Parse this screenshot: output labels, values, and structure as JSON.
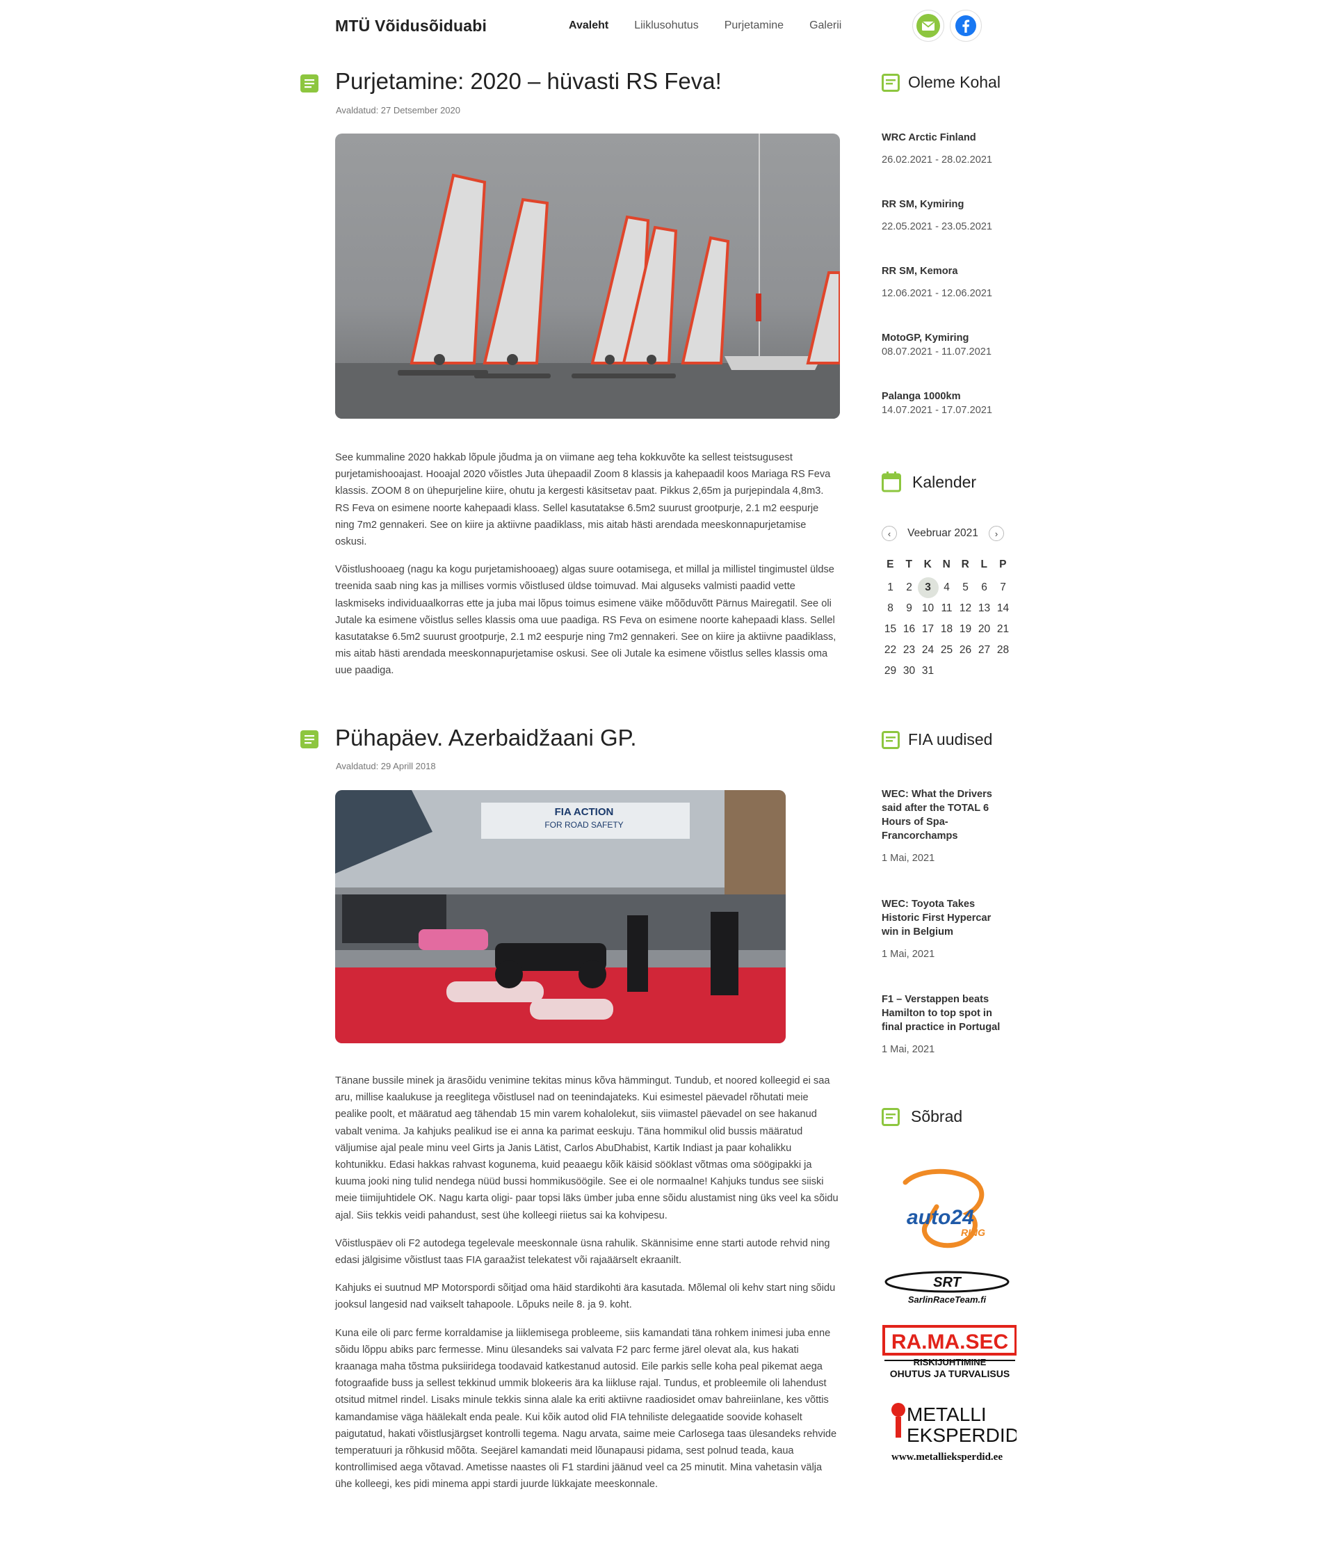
{
  "header": {
    "brand": "MTÜ Võidusõiduabi",
    "nav": [
      {
        "label": "Avaleht",
        "active": true
      },
      {
        "label": "Liiklusohutus",
        "active": false
      },
      {
        "label": "Purjetamine",
        "active": false
      },
      {
        "label": "Galerii",
        "active": false
      }
    ],
    "social": [
      "mail-icon",
      "facebook-icon"
    ]
  },
  "posts": [
    {
      "title": "Purjetamine: 2020 – hüvasti RS Feva!",
      "date": "Avaldatud: 27 Detsember 2020",
      "image": "sailboats-racing-photo",
      "paragraphs": [
        "See kummaline 2020 hakkab lõpule jõudma ja on viimane aeg teha kokkuvõte ka sellest teistsugusest purjetamishooajast. Hooajal 2020 võistles Juta ühepaadil Zoom 8 klassis ja kahepaadil koos Mariaga RS Feva klassis. ZOOM 8 on ühepurjeline kiire, ohutu ja kergesti käsitsetav paat. Pikkus 2,65m ja purjepindala 4,8m3. RS Feva on esimene noorte kahepaadi klass.  Sellel kasutatakse 6.5m2 suurust grootpurje, 2.1 m2 eespurje ning 7m2 gennakeri. See on kiire ja aktiivne paadiklass, mis aitab hästi arendada meeskonnapurjetamise oskusi.",
        "Võistlushooaeg (nagu ka kogu purjetamishooaeg) algas suure ootamisega, et millal ja millistel tingimustel üldse treenida saab ning kas ja millises vormis võistlused üldse toimuvad. Mai alguseks valmisti paadid vette laskmiseks individuaalkorras ette ja juba mai lõpus toimus esimene väike mõõduvõtt Pärnus Mairegatil. See oli Jutale ka esimene võistlus selles klassis oma uue paadiga. RS Feva on esimene noorte kahepaadi klass.  Sellel kasutatakse 6.5m2 suurust grootpurje, 2.1 m2 eespurje ning 7m2 gennakeri. See on kiire ja aktiivne paadiklass, mis aitab hästi arendada meeskonnapurjetamise oskusi. See oli Jutale ka esimene võistlus selles klassis oma uue paadiga."
      ]
    },
    {
      "title": "Pühapäev. Azerbaidžaani GP.",
      "date": "Avaldatud: 29 Aprill 2018",
      "image": "f1-parc-ferme-photo",
      "image_banner": [
        "FIA ACTION",
        "FOR ROAD SAFETY"
      ],
      "paragraphs": [
        "Tänane bussile minek ja ärasõidu venimine tekitas minus kõva hämmingut. Tundub, et noored kolleegid ei saa aru, millise kaalukuse ja reeglitega võistlusel nad on teenindajateks. Kui esimestel päevadel rõhutati meie pealike poolt,  et määratud aeg tähendab 15 min varem kohalolekut, siis viimastel päevadel on see hakanud vabalt venima. Ja kahjuks pealikud ise ei anna ka parimat eeskuju. Täna hommikul olid bussis määratud väljumise ajal peale minu veel Girts ja Janis Lätist, Carlos AbuDhabist, Kartik Indiast ja paar kohalikku kohtunikku. Edasi hakkas rahvast kogunema, kuid peaaegu kõik käisid sööklast võtmas oma söögipakki ja kuuma jooki ning tulid nendega nüüd bussi hommikusöögile. See ei ole normaalne! Kahjuks tundus see siiski meie tiimijuhtidele OK. Nagu karta oligi- paar topsi läks ümber juba enne sõidu alustamist ning üks veel ka sõidu ajal. Siis tekkis veidi pahandust, sest ühe kolleegi riietus sai ka kohvipesu.",
        "Võistluspäev oli F2 autodega tegelevale meeskonnale üsna rahulik. Skännisime enne starti autode rehvid ning edasi jälgisime võistlust taas FIA garaažist telekatest või rajaäärselt ekraanilt.",
        "Kahjuks ei suutnud MP Motorspordi sõitjad oma häid stardikohti ära kasutada. Mõlemal oli kehv start ning sõidu jooksul langesid nad vaikselt tahapoole. Lõpuks neile 8. ja 9. koht.",
        "Kuna eile oli parc ferme korraldamise ja liiklemisega probleeme, siis kamandati täna rohkem inimesi juba enne sõidu lõppu abiks parc fermesse. Minu ülesandeks sai valvata F2 parc ferme järel olevat ala, kus hakati kraanaga maha tõstma puksiiridega toodavaid katkestanud autosid. Eile parkis selle koha peal pikemat aega fotograafide buss ja sellest tekkinud ummik blokeeris ära ka liikluse rajal. Tundus, et probleemile oli lahendust otsitud mitmel rindel. Lisaks minule tekkis sinna alale ka eriti aktiivne raadiosidet omav bahreiinlane, kes võttis kamandamise väga häälekalt enda peale. Kui kõik autod olid FIA tehniliste delegaatide soovide kohaselt paigutatud, hakati võistlusjärgset kontrolli tegema. Nagu arvata, saime meie Carlosega taas ülesandeks rehvide temperatuuri ja rõhkusid mõõta. Seejärel kamandati meid lõunapausi pidama, sest polnud teada, kaua kontrollimised aega võtavad. Ametisse naastes oli F1 stardini jäänud veel ca 25 minutit. Mina vahetasin välja ühe kolleegi, kes pidi minema appi stardi juurde lükkajate meeskonnale."
      ]
    }
  ],
  "sidebar": {
    "oleme_kohal": {
      "title": "Oleme Kohal",
      "events": [
        {
          "title": "WRC Arctic Finland",
          "date": "26.02.2021 - 28.02.2021"
        },
        {
          "title": "RR SM, Kymiring",
          "date": "22.05.2021 - 23.05.2021"
        },
        {
          "title": "RR SM, Kemora",
          "date": "12.06.2021 - 12.06.2021"
        },
        {
          "title": "MotoGP, Kymiring",
          "date": "08.07.2021 - 11.07.2021"
        },
        {
          "title": "Palanga 1000km",
          "date": "14.07.2021 - 17.07.2021"
        }
      ]
    },
    "calendar": {
      "title": "Kalender",
      "month": "Veebruar 2021",
      "prev": "‹",
      "next": "›",
      "weekdays": [
        "E",
        "T",
        "K",
        "N",
        "R",
        "L",
        "P"
      ],
      "days": [
        "1",
        "2",
        "3",
        "4",
        "5",
        "6",
        "7",
        "8",
        "9",
        "10",
        "11",
        "12",
        "13",
        "14",
        "15",
        "16",
        "17",
        "18",
        "19",
        "20",
        "21",
        "22",
        "23",
        "24",
        "25",
        "26",
        "27",
        "28",
        "29",
        "30",
        "31"
      ],
      "today": "3"
    },
    "fia": {
      "title": "FIA uudised",
      "items": [
        {
          "title": "WEC: What the Drivers said after the TOTAL 6 Hours of Spa-Francorchamps",
          "date": "1 Mai, 2021"
        },
        {
          "title": "WEC: Toyota Takes Historic First Hypercar win in Belgium",
          "date": "1 Mai, 2021"
        },
        {
          "title": "F1 – Verstappen beats Hamilton to top spot in final practice in Portugal",
          "date": "1 Mai, 2021"
        }
      ]
    },
    "friends": {
      "title": "Sõbrad",
      "logos": [
        {
          "name": "auto24ring-logo",
          "text1": "auto24",
          "text2": "RING"
        },
        {
          "name": "srt-logo",
          "text1": "SRT",
          "text2": "SarlinRaceTeam.fi"
        },
        {
          "name": "ramasec-logo",
          "text1": "RA.MA.SEC",
          "text2": "RISKIJUHTIMINE",
          "text3": "OHUTUS JA TURVALISUS"
        },
        {
          "name": "metallieksperdid-logo",
          "text1": "METALLI",
          "text2": "EKSPERDID",
          "text3": "www.metallieksperdid.ee"
        }
      ]
    }
  },
  "colors": {
    "accent_green": "#8dc63f",
    "facebook_blue": "#1877f2",
    "ramasec_red": "#e2231a",
    "auto24_orange": "#f08a24"
  }
}
